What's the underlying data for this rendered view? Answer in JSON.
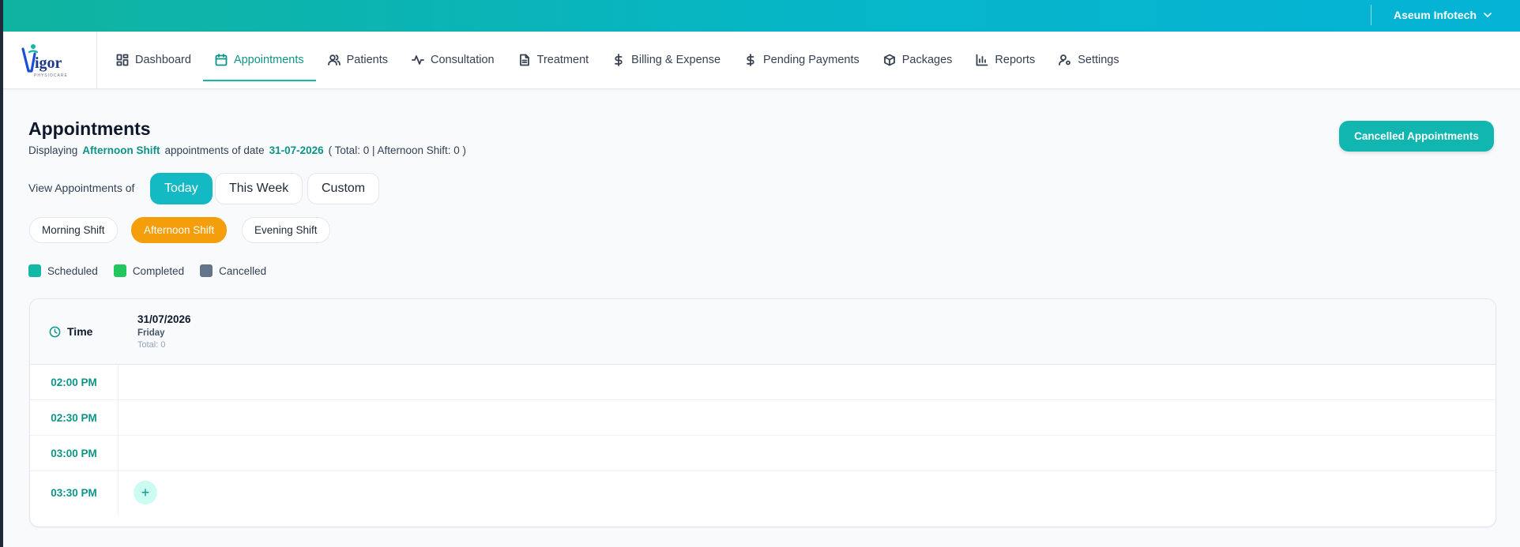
{
  "topbar": {
    "org_name": "Aseum Infotech"
  },
  "brand": {
    "logo_text": "igor",
    "logo_tagline": "PHYSIOCARE"
  },
  "nav": {
    "items": [
      {
        "label": "Dashboard",
        "icon": "dashboard-icon"
      },
      {
        "label": "Appointments",
        "icon": "calendar-icon",
        "active": true
      },
      {
        "label": "Patients",
        "icon": "users-icon"
      },
      {
        "label": "Consultation",
        "icon": "activity-icon"
      },
      {
        "label": "Treatment",
        "icon": "document-icon"
      },
      {
        "label": "Billing & Expense",
        "icon": "dollar-icon"
      },
      {
        "label": "Pending Payments",
        "icon": "dollar-icon"
      },
      {
        "label": "Packages",
        "icon": "box-icon"
      },
      {
        "label": "Reports",
        "icon": "bar-chart-icon"
      },
      {
        "label": "Settings",
        "icon": "user-settings-icon"
      }
    ]
  },
  "page": {
    "title": "Appointments",
    "subtitle_prefix": "Displaying",
    "shift_label": "Afternoon Shift",
    "subtitle_mid": "appointments of date",
    "date": "31-07-2026",
    "summary": "( Total: 0 | Afternoon Shift: 0 )",
    "cancelled_button": "Cancelled Appointments"
  },
  "view": {
    "label": "View Appointments of",
    "options": [
      "Today",
      "This Week",
      "Custom"
    ],
    "selected": "Today"
  },
  "shifts": {
    "options": [
      "Morning Shift",
      "Afternoon Shift",
      "Evening Shift"
    ],
    "selected": "Afternoon Shift"
  },
  "legend": [
    {
      "label": "Scheduled",
      "color": "#14b8a6"
    },
    {
      "label": "Completed",
      "color": "#22c55e"
    },
    {
      "label": "Cancelled",
      "color": "#64748b"
    }
  ],
  "schedule": {
    "time_header": "Time",
    "day": {
      "date": "31/07/2026",
      "weekday": "Friday",
      "total": "Total: 0"
    },
    "slots": [
      "02:00 PM",
      "02:30 PM",
      "03:00 PM",
      "03:30 PM"
    ],
    "add_label": "+"
  },
  "colors": {
    "accent": "#14b8a6",
    "shift_active": "#f59e0b",
    "range_active": "#14bac3"
  }
}
